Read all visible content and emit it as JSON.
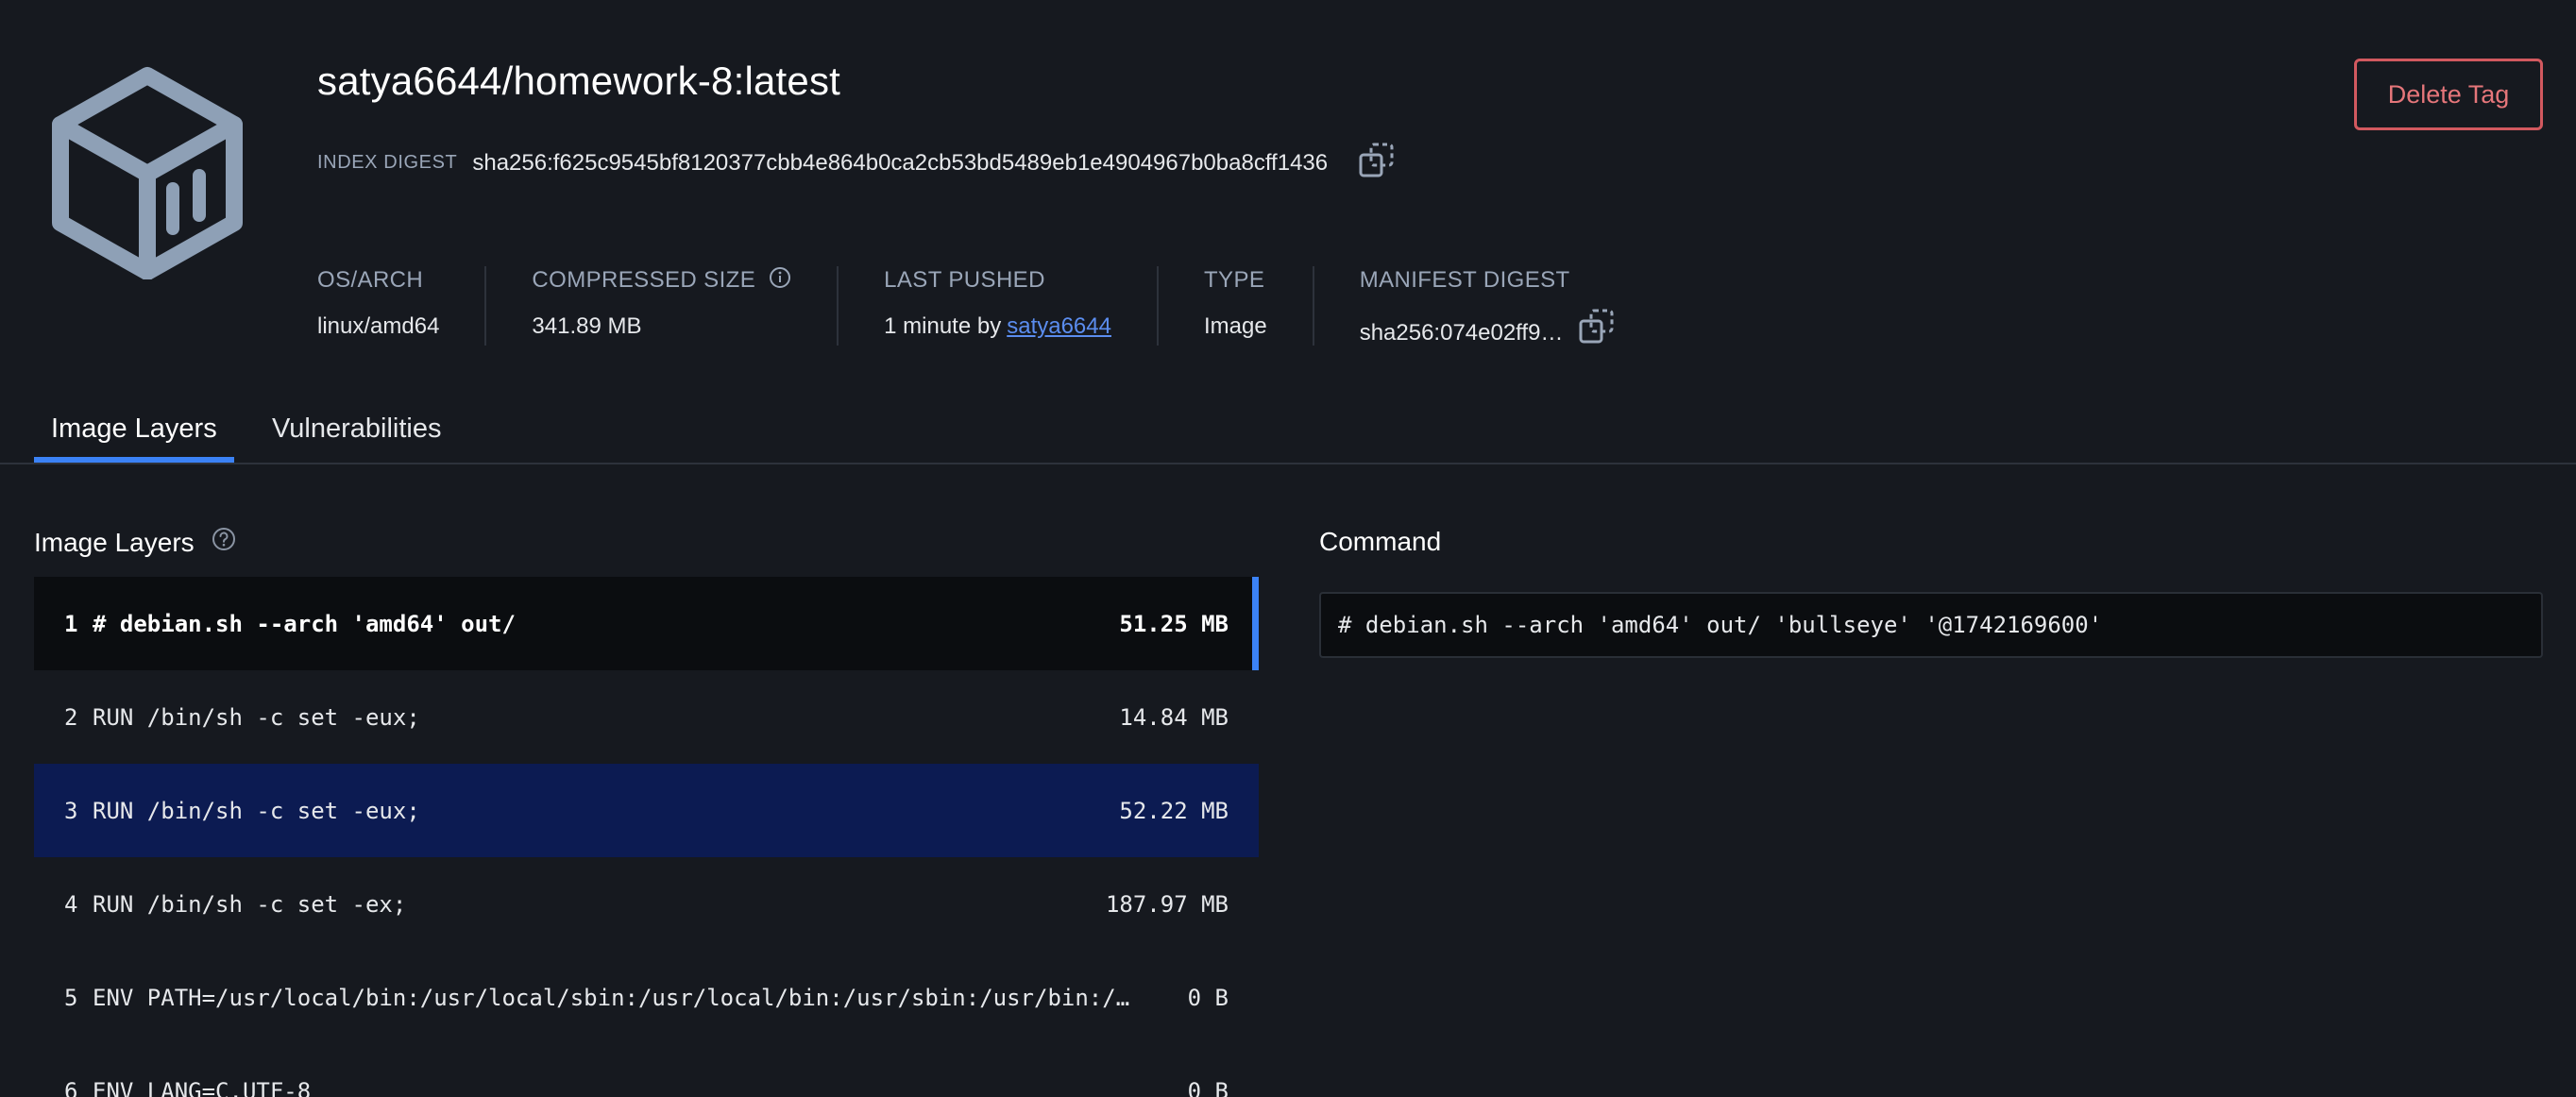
{
  "header": {
    "title": "satya6644/homework-8:latest",
    "index_digest_label": "INDEX DIGEST",
    "index_digest_value": "sha256:f625c9545bf8120377cbb4e864b0ca2cb53bd5489eb1e4904967b0ba8cff1436",
    "delete_button": "Delete Tag",
    "icon": "box-icon"
  },
  "meta": {
    "os_arch": {
      "label": "OS/ARCH",
      "value": "linux/amd64"
    },
    "compressed_size": {
      "label": "COMPRESSED SIZE",
      "value": "341.89 MB"
    },
    "last_pushed": {
      "label": "LAST PUSHED",
      "value_prefix": "1 minute by",
      "user": "satya6644"
    },
    "type": {
      "label": "TYPE",
      "value": "Image"
    },
    "manifest_digest": {
      "label": "MANIFEST DIGEST",
      "value": "sha256:074e02ff9…"
    }
  },
  "tabs": [
    {
      "label": "Image Layers",
      "active": true
    },
    {
      "label": "Vulnerabilities",
      "active": false
    }
  ],
  "layers_panel": {
    "title": "Image Layers",
    "layers": [
      {
        "index": "1",
        "command": "# debian.sh --arch 'amd64' out/",
        "size": "51.25 MB"
      },
      {
        "index": "2",
        "command": "RUN /bin/sh -c set -eux;",
        "size": "14.84 MB"
      },
      {
        "index": "3",
        "command": "RUN /bin/sh -c set -eux;",
        "size": "52.22 MB"
      },
      {
        "index": "4",
        "command": "RUN /bin/sh -c set -ex;",
        "size": "187.97 MB"
      },
      {
        "index": "5",
        "command": "ENV PATH=/usr/local/bin:/usr/local/sbin:/usr/local/bin:/usr/sbin:/usr/bin:/…",
        "size": "0 B"
      },
      {
        "index": "6",
        "command": "ENV LANG=C.UTF-8",
        "size": "0 B"
      }
    ]
  },
  "command_panel": {
    "title": "Command",
    "value": "# debian.sh --arch 'amd64' out/ 'bullseye' '@1742169600'"
  },
  "colors": {
    "background": "#16191f",
    "accent": "#3b82f6",
    "danger": "#d2595f",
    "link": "#5b8def",
    "selected_row": "#0b0d10",
    "hover_row": "#0c1b52"
  }
}
